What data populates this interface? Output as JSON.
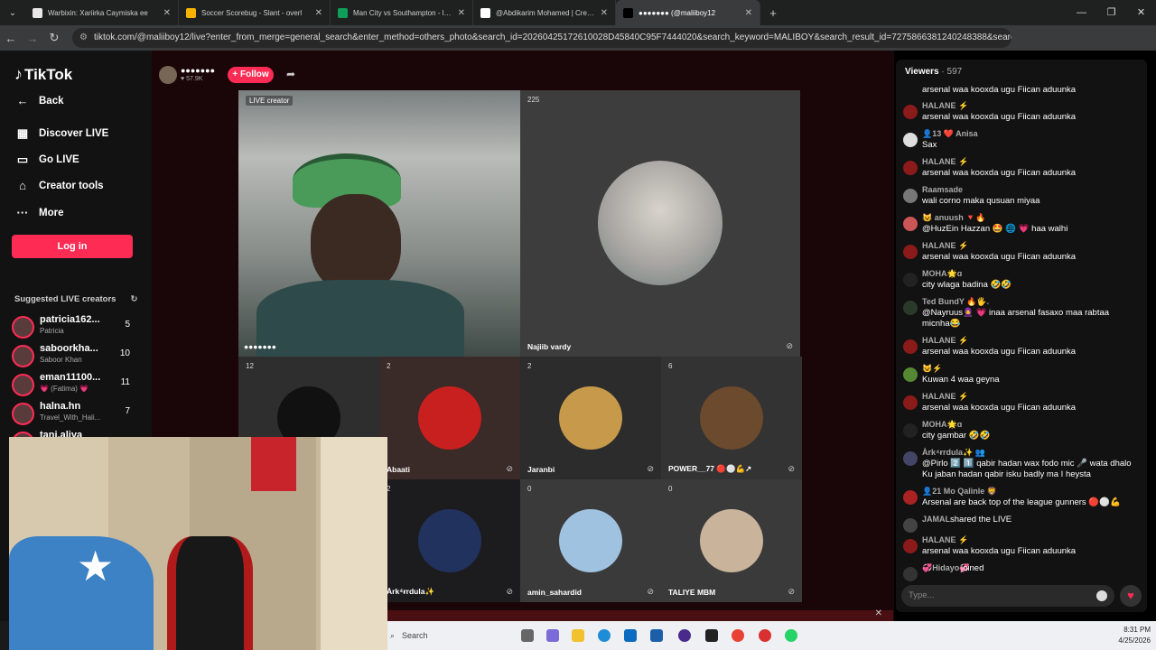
{
  "browser": {
    "tabs": [
      {
        "title": "Warbixin: Xariirka Caymiska ee",
        "icon_color": "#e8e8e8",
        "active": false
      },
      {
        "title": "Soccer Scorebug - Slant - overl",
        "icon_color": "#f4b400",
        "active": false
      },
      {
        "title": "Man City vs Southampton - live",
        "icon_color": "#0f9d58",
        "active": false
      },
      {
        "title": "@Abdikarim Mohamed | Creato",
        "icon_color": "#ffffff",
        "active": false
      },
      {
        "title": "●●●●●●● (@maliiboy12",
        "icon_color": "#000000",
        "active": true
      }
    ],
    "new_tab": "+",
    "url": "tiktok.com/@maliiboy12/live?enter_from_merge=general_search&enter_method=others_photo&search_id=20260425172610028D45840C95F7444020&search_keyword=MALIBOY&search_result_id=7275866381240248388&search_type=..."
  },
  "sidebar": {
    "logo": "TikTok",
    "nav": [
      {
        "label": "Back",
        "icon": "back-icon",
        "glyph": "←"
      },
      {
        "label": "Discover LIVE",
        "icon": "discover-live-icon",
        "glyph": "▦"
      },
      {
        "label": "Go LIVE",
        "icon": "camera-icon",
        "glyph": "▭"
      },
      {
        "label": "Creator tools",
        "icon": "home-icon",
        "glyph": "⌂"
      },
      {
        "label": "More",
        "icon": "more-icon",
        "glyph": "···"
      }
    ],
    "login": "Log in",
    "suggested_title": "Suggested LIVE creators",
    "creators": [
      {
        "name": "patricia162...",
        "sub": "Patricia",
        "count": "5"
      },
      {
        "name": "saboorkha...",
        "sub": "Saboor Khan",
        "count": "10"
      },
      {
        "name": "eman11100...",
        "sub": "💗 (Fatima) 💗",
        "count": "11"
      },
      {
        "name": "halna.hn",
        "sub": "Travel_With_Hali...",
        "count": "7"
      },
      {
        "name": "tanj.aliya",
        "sub": "",
        "count": ""
      }
    ]
  },
  "live": {
    "host_name": "●●●●●●●",
    "host_likes": "♥ 57.9K",
    "follow": "+ Follow",
    "main_tile": {
      "label": "LIVE creator",
      "name": "●●●●●●●"
    },
    "guest_main": {
      "count": "225",
      "name": "Najiib vardy"
    },
    "tiles": [
      {
        "count": "12",
        "name": ""
      },
      {
        "count": "2",
        "name": "Abaati"
      },
      {
        "count": "2",
        "name": "Jaranbi"
      },
      {
        "count": "6",
        "name": "POWER__77 🔴⚪💪↗"
      },
      {
        "count": "2",
        "name": "Ȧrk⁴ɍrdula✨"
      },
      {
        "count": "0",
        "name": "amin_sahardid"
      },
      {
        "count": "0",
        "name": "TALIYE MBM"
      }
    ]
  },
  "chat": {
    "viewers_label": "Viewers",
    "viewers_count": "· 597",
    "messages": [
      {
        "user": "",
        "text": "arsenal waa kooxda ugu Fiican aduunka",
        "color": "#8b1a1a"
      },
      {
        "user": "HALANE ⚡",
        "text": "arsenal waa kooxda ugu Fiican aduunka",
        "color": "#8b1a1a"
      },
      {
        "user": "👤13 ❤️ Anisa",
        "text": "Sax",
        "color": "#dddddd"
      },
      {
        "user": "HALANE ⚡",
        "text": "arsenal waa kooxda ugu Fiican aduunka",
        "color": "#8b1a1a"
      },
      {
        "user": "Raamsade",
        "text": "wali corno maka qusuan miyaa",
        "color": "#777777"
      },
      {
        "user": "😺 anuush 🔻🔥",
        "text": "@HuzEin Hazzan 🤩 🌐 💗 haa walhi",
        "color": "#cc5555"
      },
      {
        "user": "HALANE ⚡",
        "text": "arsenal waa kooxda ugu Fiican aduunka",
        "color": "#8b1a1a"
      },
      {
        "user": "MOHA🌟ɑ",
        "text": "city wlaga badina 🤣🤣",
        "color": "#222222"
      },
      {
        "user": "Ted BundY 🔥🖐.",
        "text": "@Nayruus🧕 💗 inaa arsenal fasaxo maa rabtaa micnha😂",
        "color": "#2a3a2a"
      },
      {
        "user": "HALANE ⚡",
        "text": "arsenal waa kooxda ugu Fiican aduunka",
        "color": "#8b1a1a"
      },
      {
        "user": "😺⚡",
        "text": "Kuwan 4 waa geyna",
        "color": "#558833"
      },
      {
        "user": "HALANE ⚡",
        "text": "arsenal waa kooxda ugu Fiican aduunka",
        "color": "#8b1a1a"
      },
      {
        "user": "MOHA🌟ɑ",
        "text": "city gambar 🤣🤣",
        "color": "#222222"
      },
      {
        "user": "Ȧrk⁴ɍrdula✨ 👥",
        "text": "@Pirlo 2️⃣ 1️⃣ qabir hadan wax fodo mic 🎤 wata dhalo Ku jaban hadan qabir isku badly ma I heysta",
        "color": "#444466"
      },
      {
        "user": "👤21 Mo Qalinle 🦁",
        "text": "Arsenal are back top of the league gunners 🔴⚪💪",
        "color": "#aa2222"
      },
      {
        "user": "JAMAL",
        "text": "shared the LIVE",
        "color": "#444444"
      },
      {
        "user": "HALANE ⚡",
        "text": "arsenal waa kooxda ugu Fiican aduunka",
        "color": "#8b1a1a"
      },
      {
        "user": "💞Hidayo💞",
        "text": "joined",
        "color": "#333333"
      }
    ],
    "input_placeholder": "Type..."
  },
  "taskbar": {
    "search": "Search",
    "time": "8:31 PM",
    "date": "4/25/2026"
  }
}
